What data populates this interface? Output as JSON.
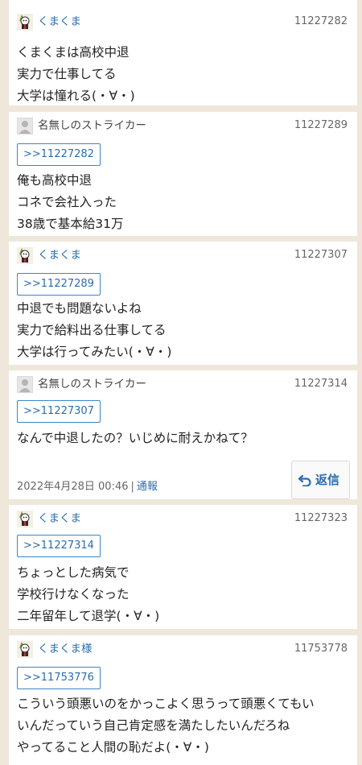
{
  "posts": [
    {
      "name": "くまくま",
      "number": "11227282",
      "anchor": "",
      "lines": [
        "くまくまは高校中退",
        "実力で仕事してる",
        "大学は憧れる(・∀・)"
      ]
    },
    {
      "name": "名無しのストライカー",
      "number": "11227289",
      "anchor": ">>11227282",
      "lines": [
        "俺も高校中退",
        "コネで会社入った",
        "38歳で基本給31万"
      ]
    },
    {
      "name": "くまくま",
      "number": "11227307",
      "anchor": ">>11227289",
      "lines": [
        "中退でも問題ないよね",
        "実力で給料出る仕事してる",
        "大学は行ってみたい(・∀・)"
      ]
    },
    {
      "name": "名無しのストライカー",
      "number": "11227314",
      "anchor": ">>11227307",
      "lines": [
        "なんで中退したの？いじめに耐えかねて？"
      ],
      "date": "2022年4月28日 00:46",
      "separator": "|",
      "report_label": "通報",
      "reply_label": "返信"
    },
    {
      "name": "くまくま",
      "number": "11227323",
      "anchor": ">>11227314",
      "lines": [
        "ちょっとした病気で",
        "学校行けなくなった",
        "二年留年して退学(・∀・)"
      ]
    },
    {
      "name": "くまくま様",
      "number": "11753778",
      "anchor": ">>11753776",
      "lines": [
        "こういう頭悪いのをかっこよく思うって頭悪くてもい",
        "いんだっていう自己肯定感を満たしたいんだろね",
        "やってること人間の恥だよ(・∀・)"
      ]
    }
  ],
  "colors": {
    "page_background": "#efe7da",
    "link": "#2a6db0",
    "anchor_border": "#3a86c8"
  },
  "icons": {
    "named_avatar": "bear-mascot-icon",
    "anon_avatar": "person-silhouette-icon",
    "reply": "reply-arrow-icon"
  }
}
